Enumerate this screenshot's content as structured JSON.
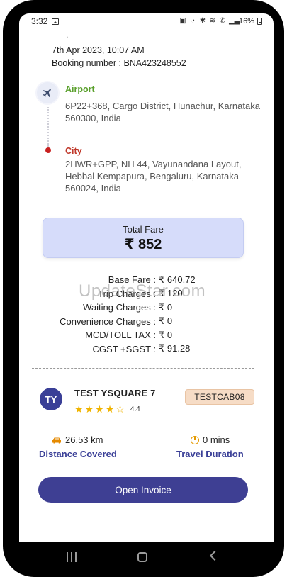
{
  "status": {
    "time": "3:32",
    "battery": "16%"
  },
  "top_dot": ".",
  "booking": {
    "date": "7th Apr 2023, 10:07 AM",
    "number": "Booking number : BNA423248552"
  },
  "pickup": {
    "label": "Airport",
    "address": "6P22+368, Cargo District, Hunachur, Karnataka 560300, India"
  },
  "drop": {
    "label": "City",
    "address": "2HWR+GPP, NH 44, Vayunandana Layout, Hebbal Kempapura, Bengaluru, Karnataka 560024, India"
  },
  "fare": {
    "title": "Total Fare",
    "value": "₹ 852"
  },
  "breakdown": [
    {
      "key": "Base Fare :",
      "value": "₹ 640.72"
    },
    {
      "key": "Trip Charges :",
      "value": "₹ 120"
    },
    {
      "key": "Waiting Charges :",
      "value": "₹ 0"
    },
    {
      "key": "Convenience Charges :",
      "value": "₹ 0"
    },
    {
      "key": "MCD/TOLL TAX :",
      "value": "₹ 0"
    },
    {
      "key": "CGST +SGST :",
      "value": "₹ 91.28"
    }
  ],
  "watermark": "UpdateStar.com",
  "driver": {
    "initials": "TY",
    "name": "TEST YSQUARE 7",
    "rating": "4.4",
    "rating_value": 4.4,
    "cab_number": "TESTCAB08"
  },
  "trip_stats": {
    "distance_value": "26.53 km",
    "distance_label": "Distance Covered",
    "duration_value": "0 mins",
    "duration_label": "Travel Duration"
  },
  "actions": {
    "open_invoice": "Open Invoice"
  },
  "colors": {
    "primary": "#3e3f93",
    "pickup_green": "#5aa02c",
    "drop_red": "#c0392b",
    "fare_card_bg": "#d6dcfa",
    "star": "#f0b400"
  }
}
